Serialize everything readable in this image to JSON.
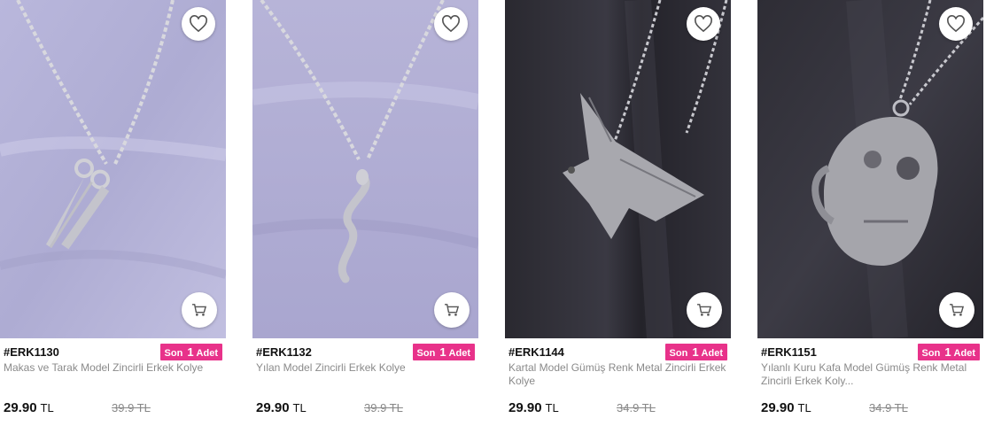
{
  "products": [
    {
      "code": "#ERK1130",
      "badge": {
        "prefix": "Son",
        "count": "1",
        "suffix": "Adet"
      },
      "name": "Makas ve Tarak Model Zincirli Erkek Kolye",
      "price": "29.90",
      "currency": "TL",
      "old_price": "39.9 TL",
      "image_icon": "necklace-scissors-comb"
    },
    {
      "code": "#ERK1132",
      "badge": {
        "prefix": "Son",
        "count": "1",
        "suffix": "Adet"
      },
      "name": "Yılan Model Zincirli Erkek Kolye",
      "price": "29.90",
      "currency": "TL",
      "old_price": "39.9 TL",
      "image_icon": "necklace-snake"
    },
    {
      "code": "#ERK1144",
      "badge": {
        "prefix": "Son",
        "count": "1",
        "suffix": "Adet"
      },
      "name": "Kartal Model Gümüş Renk Metal Zincirli Erkek Kolye",
      "price": "29.90",
      "currency": "TL",
      "old_price": "34.9 TL",
      "image_icon": "necklace-eagle"
    },
    {
      "code": "#ERK1151",
      "badge": {
        "prefix": "Son",
        "count": "1",
        "suffix": "Adet"
      },
      "name": "Yılanlı Kuru Kafa Model Gümüş Renk Metal Zincirli Erkek Koly...",
      "price": "29.90",
      "currency": "TL",
      "old_price": "34.9 TL",
      "image_icon": "necklace-skull-snake"
    }
  ],
  "colors": {
    "badge": "#e8328a",
    "lavender_bg": "#b6b3d6",
    "dark_bg": "#2b2a33"
  },
  "icons": {
    "favorite": "heart-icon",
    "cart": "cart-icon"
  }
}
